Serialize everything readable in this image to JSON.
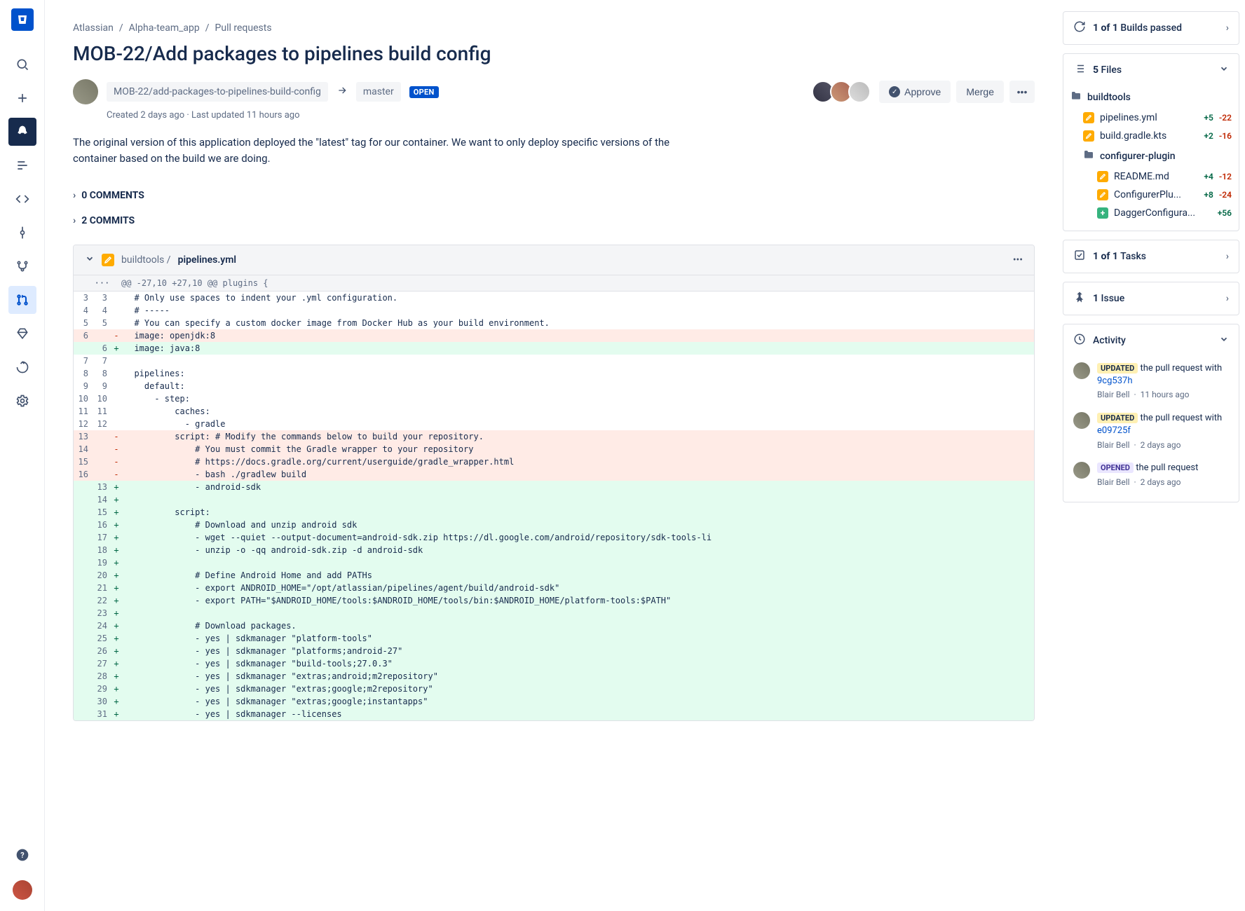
{
  "breadcrumb": {
    "org": "Atlassian",
    "repo": "Alpha-team_app",
    "section": "Pull requests"
  },
  "title": "MOB-22/Add packages to pipelines build config",
  "branch": {
    "source": "MOB-22/add-packages-to-pipelines-build-config",
    "target": "master",
    "status": "OPEN"
  },
  "meta": "Created 2 days ago · Last updated 11 hours ago",
  "description": "The original version of this application deployed the \"latest\" tag for our container. We want to only deploy specific versions of the container based on the build we are doing.",
  "actions": {
    "approve": "Approve",
    "merge": "Merge"
  },
  "sections": {
    "comments": "0 COMMENTS",
    "commits": "2 COMMITS"
  },
  "diff": {
    "path": "buildtools / ",
    "file": "pipelines.yml",
    "hunk": "@@ -27,10 +27,10 @@ plugins {",
    "ellipsis": "···",
    "rows": [
      {
        "t": "ctx",
        "o": "3",
        "n": "3",
        "c": "  # Only use spaces to indent your .yml configuration."
      },
      {
        "t": "ctx",
        "o": "4",
        "n": "4",
        "c": "  # -----"
      },
      {
        "t": "ctx",
        "o": "5",
        "n": "5",
        "c": "  # You can specify a custom docker image from Docker Hub as your build environment."
      },
      {
        "t": "del",
        "o": "6",
        "n": "",
        "c": "  image: openjdk:8"
      },
      {
        "t": "add",
        "o": "",
        "n": "6",
        "c": "  image: java:8"
      },
      {
        "t": "ctx",
        "o": "7",
        "n": "7",
        "c": ""
      },
      {
        "t": "ctx",
        "o": "8",
        "n": "8",
        "c": "  pipelines:"
      },
      {
        "t": "ctx",
        "o": "9",
        "n": "9",
        "c": "    default:"
      },
      {
        "t": "ctx",
        "o": "10",
        "n": "10",
        "c": "      - step:"
      },
      {
        "t": "ctx",
        "o": "11",
        "n": "11",
        "c": "          caches:"
      },
      {
        "t": "ctx",
        "o": "12",
        "n": "12",
        "c": "            - gradle"
      },
      {
        "t": "del",
        "o": "13",
        "n": "",
        "c": "          script: # Modify the commands below to build your repository."
      },
      {
        "t": "del",
        "o": "14",
        "n": "",
        "c": "              # You must commit the Gradle wrapper to your repository"
      },
      {
        "t": "del",
        "o": "15",
        "n": "",
        "c": "              # https://docs.gradle.org/current/userguide/gradle_wrapper.html"
      },
      {
        "t": "del",
        "o": "16",
        "n": "",
        "c": "              - bash ./gradlew build"
      },
      {
        "t": "add",
        "o": "",
        "n": "13",
        "c": "              - android-sdk"
      },
      {
        "t": "add",
        "o": "",
        "n": "14",
        "c": ""
      },
      {
        "t": "add",
        "o": "",
        "n": "15",
        "c": "          script:"
      },
      {
        "t": "add",
        "o": "",
        "n": "16",
        "c": "              # Download and unzip android sdk"
      },
      {
        "t": "add",
        "o": "",
        "n": "17",
        "c": "              - wget --quiet --output-document=android-sdk.zip https://dl.google.com/android/repository/sdk-tools-li"
      },
      {
        "t": "add",
        "o": "",
        "n": "18",
        "c": "              - unzip -o -qq android-sdk.zip -d android-sdk"
      },
      {
        "t": "add",
        "o": "",
        "n": "19",
        "c": ""
      },
      {
        "t": "add",
        "o": "",
        "n": "20",
        "c": "              # Define Android Home and add PATHs"
      },
      {
        "t": "add",
        "o": "",
        "n": "21",
        "c": "              - export ANDROID_HOME=\"/opt/atlassian/pipelines/agent/build/android-sdk\""
      },
      {
        "t": "add",
        "o": "",
        "n": "22",
        "c": "              - export PATH=\"$ANDROID_HOME/tools:$ANDROID_HOME/tools/bin:$ANDROID_HOME/platform-tools:$PATH\""
      },
      {
        "t": "add",
        "o": "",
        "n": "23",
        "c": ""
      },
      {
        "t": "add",
        "o": "",
        "n": "24",
        "c": "              # Download packages."
      },
      {
        "t": "add",
        "o": "",
        "n": "25",
        "c": "              - yes | sdkmanager \"platform-tools\""
      },
      {
        "t": "add",
        "o": "",
        "n": "26",
        "c": "              - yes | sdkmanager \"platforms;android-27\""
      },
      {
        "t": "add",
        "o": "",
        "n": "27",
        "c": "              - yes | sdkmanager \"build-tools;27.0.3\""
      },
      {
        "t": "add",
        "o": "",
        "n": "28",
        "c": "              - yes | sdkmanager \"extras;android;m2repository\""
      },
      {
        "t": "add",
        "o": "",
        "n": "29",
        "c": "              - yes | sdkmanager \"extras;google;m2repository\""
      },
      {
        "t": "add",
        "o": "",
        "n": "30",
        "c": "              - yes | sdkmanager \"extras;google;instantapps\""
      },
      {
        "t": "add",
        "o": "",
        "n": "31",
        "c": "              - yes | sdkmanager --licenses"
      }
    ]
  },
  "panels": {
    "builds": "1 of 1 Builds passed",
    "files_label": "5 Files",
    "tasks": "1 of 1 Tasks",
    "issue": "1 Issue",
    "activity": "Activity"
  },
  "tree": {
    "folder1": "buildtools",
    "file1": {
      "name": "pipelines.yml",
      "add": "+5",
      "del": "-22"
    },
    "file2": {
      "name": "build.gradle.kts",
      "add": "+2",
      "del": "-16"
    },
    "folder2": "configurer-plugin",
    "file3": {
      "name": "README.md",
      "add": "+4",
      "del": "-12"
    },
    "file4": {
      "name": "ConfigurerPlu...",
      "add": "+8",
      "del": "-24"
    },
    "file5": {
      "name": "DaggerConfigura...",
      "add": "+56"
    }
  },
  "activity": [
    {
      "badge": "UPDATED",
      "badgeClass": "badge-upd",
      "text": "the pull request with ",
      "link": "9cg537h",
      "author": "Blair Bell",
      "time": "11 hours ago"
    },
    {
      "badge": "UPDATED",
      "badgeClass": "badge-upd",
      "text": "the pull request with ",
      "link": "e09725f",
      "author": "Blair Bell",
      "time": "2 days ago"
    },
    {
      "badge": "OPENED",
      "badgeClass": "badge-open",
      "text": "the pull request",
      "link": "",
      "author": "Blair Bell",
      "time": "2 days ago"
    }
  ]
}
